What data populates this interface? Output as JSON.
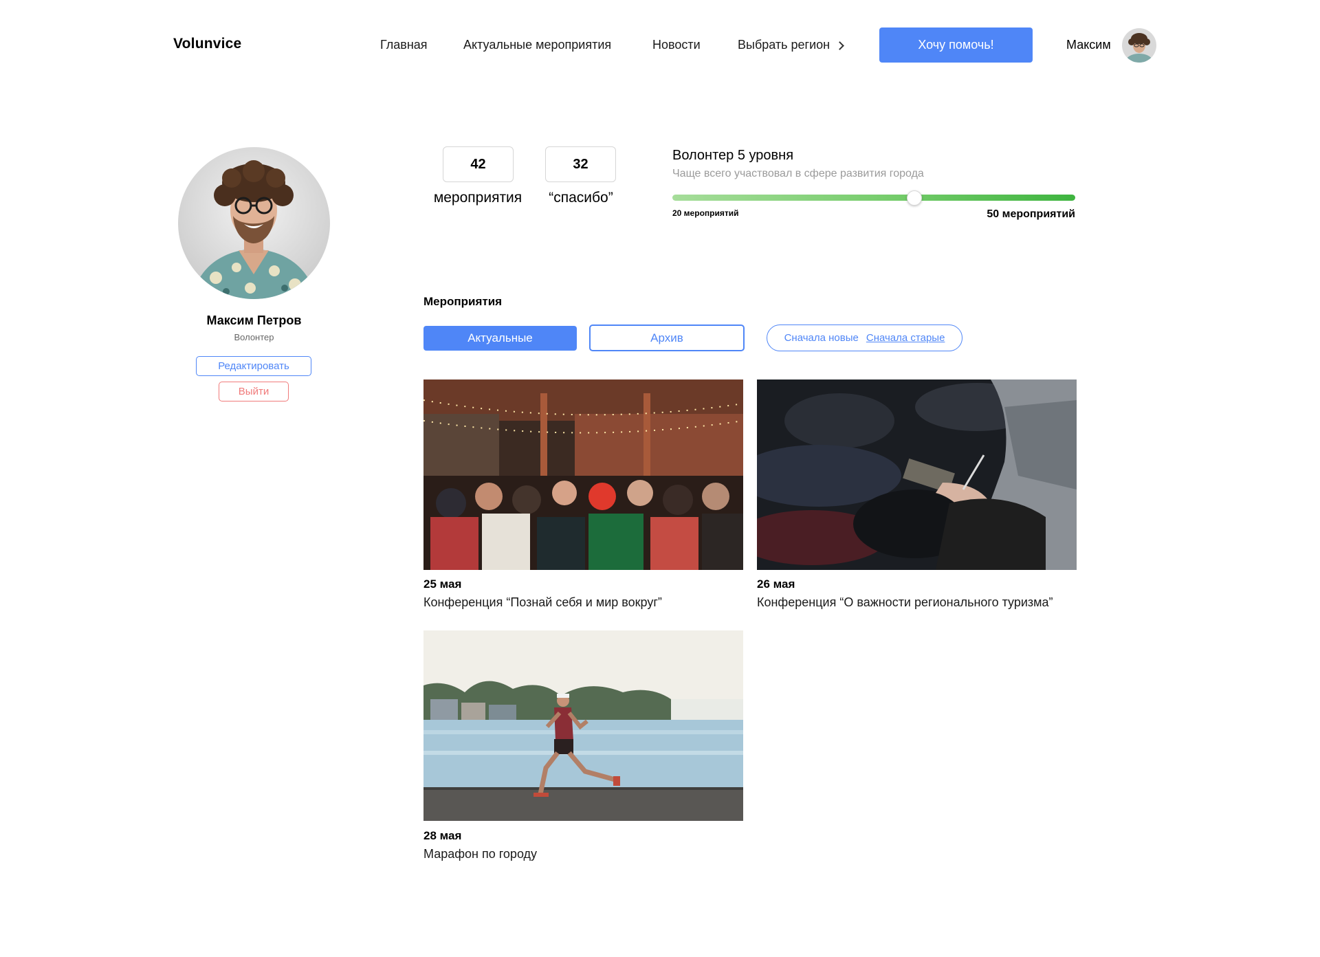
{
  "header": {
    "logo": "Volunvice",
    "nav": [
      {
        "label": "Главная"
      },
      {
        "label": "Актуальные мероприятия"
      },
      {
        "label": "Новости"
      },
      {
        "label": "Выбрать регион"
      }
    ],
    "cta_label": "Хочу помочь!",
    "user_name": "Максим"
  },
  "profile": {
    "name": "Максим Петров",
    "role": "Волонтер",
    "edit_label": "Редактировать",
    "logout_label": "Выйти"
  },
  "stats": [
    {
      "value": "42",
      "label": "мероприятия"
    },
    {
      "value": "32",
      "label": "“спасибо”"
    }
  ],
  "level": {
    "title": "Волонтер 5 уровня",
    "subtitle": "Чаще всего участвовал в сфере развития города",
    "min_label": "20 мероприятий",
    "max_label": "50 мероприятий",
    "progress_fraction": 0.6
  },
  "events": {
    "section_title": "Мероприятия",
    "tabs": [
      {
        "label": "Актуальные",
        "active": true
      },
      {
        "label": "Архив",
        "active": false
      }
    ],
    "sort": [
      {
        "label": "Сначала новые",
        "active": false
      },
      {
        "label": "Сначала старые",
        "active": true
      }
    ],
    "items": [
      {
        "date": "25 мая",
        "title": "Конференция “Познай себя и мир вокруг”"
      },
      {
        "date": "26 мая",
        "title": "Конференция “О важности регионального туризма”"
      },
      {
        "date": "28 мая",
        "title": "Марафон по городу"
      }
    ]
  },
  "colors": {
    "accent": "#4f86f7",
    "danger": "#f07a7a",
    "progress_start": "#a6dd9a",
    "progress_end": "#3eb43f"
  }
}
